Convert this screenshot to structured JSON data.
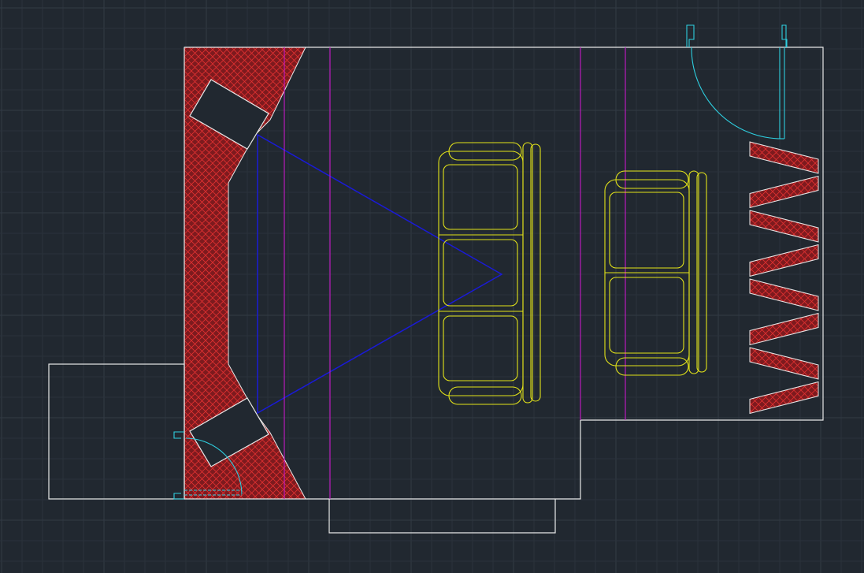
{
  "app": {
    "type": "cad-floorplan-viewport"
  },
  "colors": {
    "background": "#212830",
    "grid_minor": "#2a323b",
    "grid_major": "#323b45",
    "walls": "#e8e8e8",
    "hatch_fill": "#7d1a1e",
    "hatch_lines": "#e03030",
    "door": "#2ecfe0",
    "sightline": "#1a1ad8",
    "axis_guides": "#c819c8",
    "furniture": "#e4e419"
  },
  "layers": [
    {
      "name": "grid",
      "visible": true
    },
    {
      "name": "walls",
      "visible": true
    },
    {
      "name": "acoustic-treatment",
      "visible": true
    },
    {
      "name": "speakers",
      "visible": true
    },
    {
      "name": "doors",
      "visible": true
    },
    {
      "name": "viewing-triangle",
      "visible": true
    },
    {
      "name": "seating-guides",
      "visible": true
    },
    {
      "name": "seating",
      "visible": true
    },
    {
      "name": "diffuser-panels",
      "visible": true
    }
  ],
  "seating": {
    "front_row_seats": 3,
    "rear_row_seats": 2
  },
  "diffuser_panels": {
    "count": 8
  }
}
